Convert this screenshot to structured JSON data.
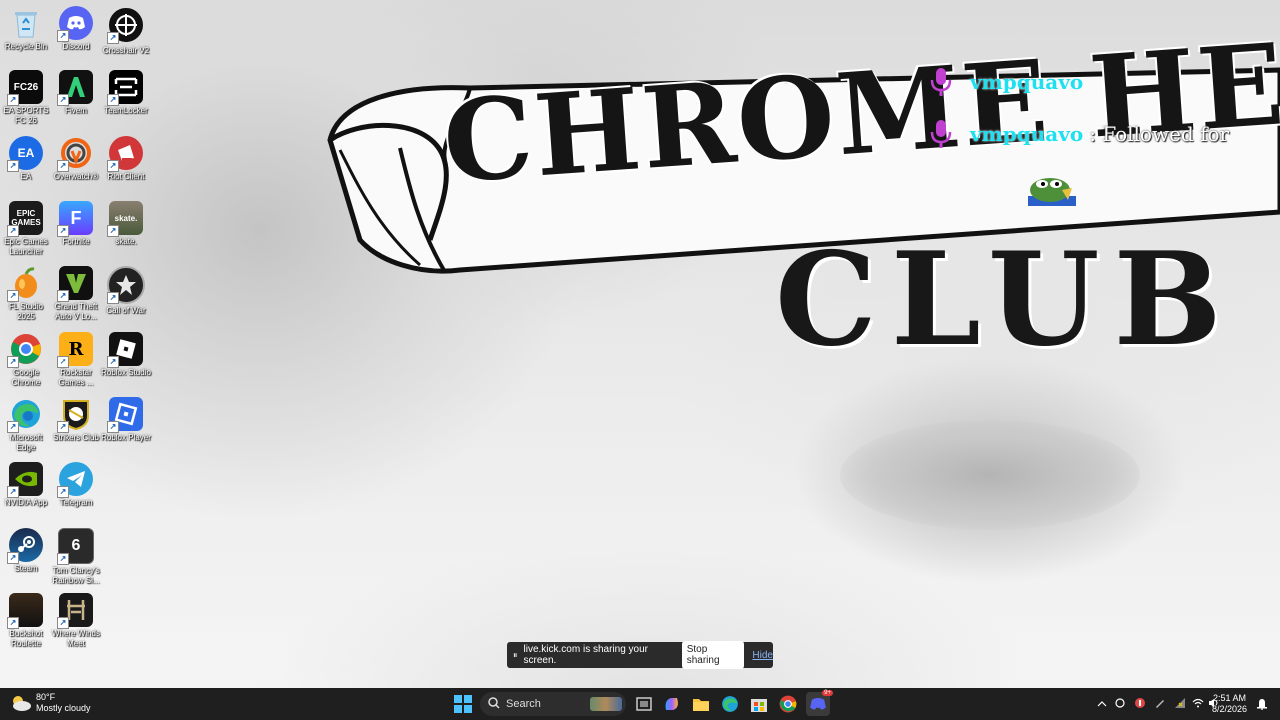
{
  "desktop": {
    "icons": [
      {
        "label": "Recycle Bin",
        "icon": "recycle-bin-icon"
      },
      {
        "label": "Discord",
        "icon": "discord-icon"
      },
      {
        "label": "Crosshair V2",
        "icon": "crosshair-icon"
      },
      {
        "label": "EA SPORTS FC 26",
        "icon": "fc26-icon"
      },
      {
        "label": "Fivem",
        "icon": "fivem-icon"
      },
      {
        "label": "TeamLocker",
        "icon": "teamlocker-icon"
      },
      {
        "label": "EA",
        "icon": "ea-icon"
      },
      {
        "label": "Overwatch®",
        "icon": "overwatch-icon"
      },
      {
        "label": "Riot Client",
        "icon": "riot-client-icon"
      },
      {
        "label": "Epic Games Launcher",
        "icon": "epic-games-icon"
      },
      {
        "label": "Fortnite",
        "icon": "fortnite-icon"
      },
      {
        "label": "skate.",
        "icon": "skate-icon"
      },
      {
        "label": "FL Studio 2025",
        "icon": "fl-studio-icon"
      },
      {
        "label": "Grand Theft Auto V Lo...",
        "icon": "gta-v-icon"
      },
      {
        "label": "Call of War",
        "icon": "call-of-war-icon"
      },
      {
        "label": "Google Chrome",
        "icon": "chrome-icon"
      },
      {
        "label": "Rockstar Games ...",
        "icon": "rockstar-icon"
      },
      {
        "label": "Roblox Studio",
        "icon": "roblox-studio-icon"
      },
      {
        "label": "Microsoft Edge",
        "icon": "edge-icon"
      },
      {
        "label": "Strikers Club",
        "icon": "strikers-club-icon"
      },
      {
        "label": "Roblox Player",
        "icon": "roblox-player-icon"
      },
      {
        "label": "NVIDIA App",
        "icon": "nvidia-icon"
      },
      {
        "label": "Telegram",
        "icon": "telegram-icon"
      },
      {
        "label": "Steam",
        "icon": "steam-icon"
      },
      {
        "label": "Tom Clancy's Rainbow Si...",
        "icon": "rainbow-six-icon"
      },
      {
        "label": "Buckshot Roulette",
        "icon": "buckshot-roulette-icon"
      },
      {
        "label": "Where Winds Meet",
        "icon": "where-winds-meet-icon"
      }
    ]
  },
  "wallpaper": {
    "banner_text": "CHROME HEA",
    "club_text": "CLUB"
  },
  "chat_overlay": {
    "lines": [
      {
        "name": "vmpquavo",
        "message": ""
      },
      {
        "name": "vmpquavo",
        "message": ": Followed for"
      }
    ],
    "name_color": "#1fe0f0",
    "mic_color": "#c040d0"
  },
  "share_bar": {
    "message": "live.kick.com is sharing your screen.",
    "stop_label": "Stop sharing",
    "hide_label": "Hide"
  },
  "taskbar": {
    "weather_temp": "80°F",
    "weather_desc": "Mostly cloudy",
    "search_label": "Search",
    "clock_time": "2:51 AM",
    "clock_date": "8/2/2026",
    "discord_badge": "9+"
  }
}
